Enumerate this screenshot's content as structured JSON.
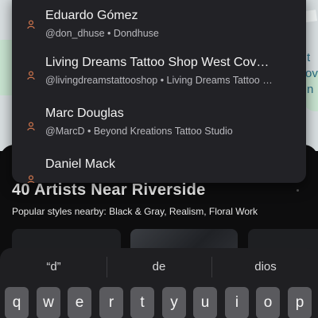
{
  "map": {
    "edge_text": "t",
    "edge_text2": "ov",
    "edge_text3": "n"
  },
  "suggestions": [
    {
      "name": "Eduardo Gómez",
      "meta": "@don_dhuse • Dondhuse"
    },
    {
      "name": "Living Dreams Tattoo Shop  West Cov…",
      "meta": "@livingdreamstattooshop • Living Dreams Tattoo …"
    },
    {
      "name": "Marc Douglas",
      "meta": "@MarcD • Beyond Kreations Tattoo Studio"
    },
    {
      "name": "Daniel Mack",
      "meta": ""
    }
  ],
  "sheet": {
    "title": "40 Artists Near Riverside",
    "subtitle": "Popular styles nearby: Black & Gray, Realism, Floral Work"
  },
  "keyboard": {
    "predictions": [
      "“d”",
      "de",
      "dios"
    ],
    "keys": [
      "q",
      "w",
      "e",
      "r",
      "t",
      "y",
      "u",
      "i",
      "o",
      "p"
    ]
  },
  "colors": {
    "pin": "#c9724b",
    "dropdown_bg": "#222226",
    "keyboard_bg": "#1f1f22"
  }
}
